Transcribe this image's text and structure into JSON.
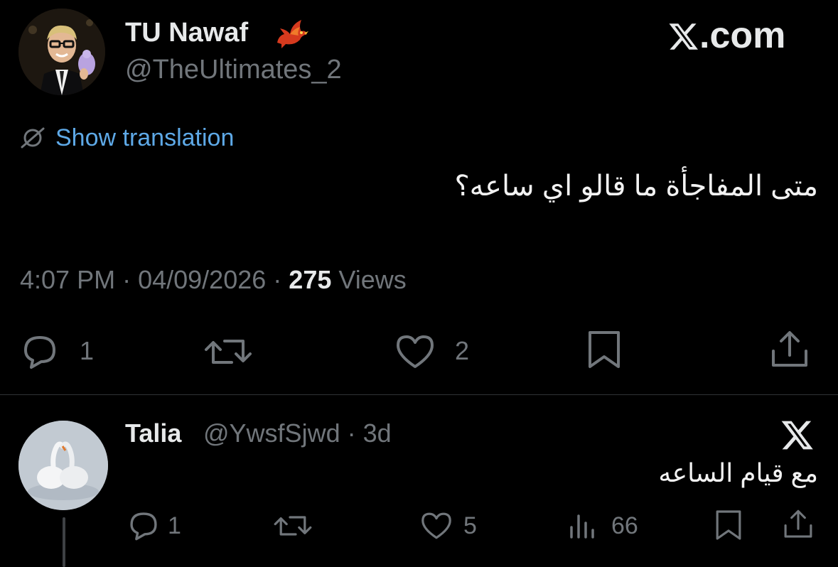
{
  "tweet": {
    "author_name": "TU Nawaf",
    "author_handle": "@TheUltimates_2",
    "author_emoji": "red-bird-emoji",
    "brand": ".com",
    "translation_label": "Show translation",
    "text": "متى المفاجأة ما قالو اي ساعه؟",
    "time": "4:07 PM",
    "date": "04/09/2026",
    "views_count": "275",
    "views_label": "Views",
    "actions": {
      "reply_count": "1",
      "repost_count": "",
      "like_count": "2"
    }
  },
  "reply": {
    "author_name": "Talia",
    "author_handle": "@YwsfSjwd",
    "age": "3d",
    "text": "مع قيام الساعه",
    "actions": {
      "reply_count": "1",
      "like_count": "5",
      "views_count": "66"
    }
  },
  "colors": {
    "background": "#000000",
    "primary_text": "#e7e9ea",
    "secondary_text": "#71767b",
    "link": "#5ea9e7",
    "divider": "#2f3336"
  }
}
